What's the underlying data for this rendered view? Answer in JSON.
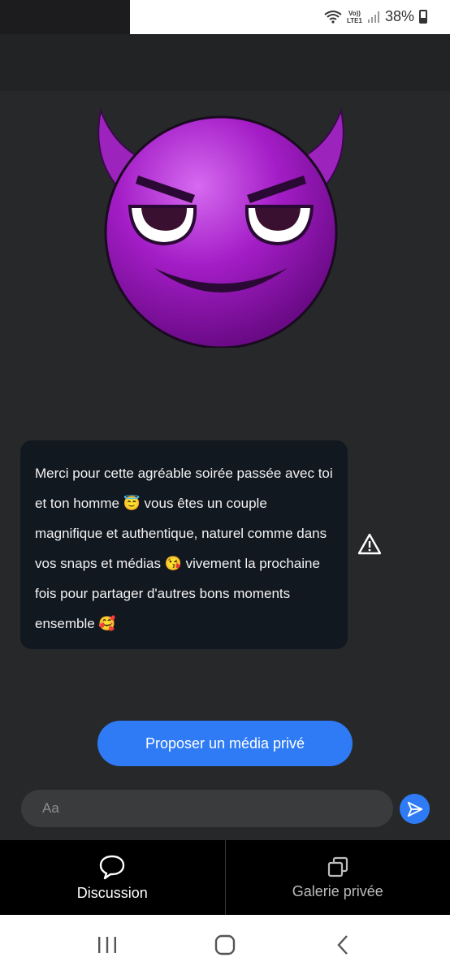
{
  "status_bar": {
    "network": "LTE1",
    "volte": "Vo))",
    "battery_percent": "38%",
    "icons": [
      "wifi-icon",
      "signal-icon",
      "battery-icon"
    ]
  },
  "message": {
    "text": "Merci pour cette agréable soirée passée avec toi et ton homme 😇 vous êtes un couple magnifique et authentique, naturel comme dans vos snaps et médias 😘 vivement la prochaine fois pour partager d'autres bons moments ensemble 🥰"
  },
  "actions": {
    "propose_label": "Proposer un média privé"
  },
  "composer": {
    "placeholder": "Aa"
  },
  "tabs": [
    {
      "label": "Discussion",
      "icon": "chat-bubble-icon",
      "active": true
    },
    {
      "label": "Galerie privée",
      "icon": "gallery-icon",
      "active": false
    }
  ],
  "colors": {
    "background": "#27282a",
    "bubble": "#121820",
    "accent": "#2e7bf5",
    "tab_bar": "#000000"
  }
}
